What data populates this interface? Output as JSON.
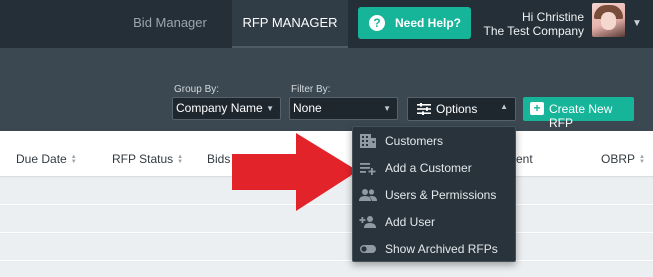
{
  "nav": {
    "tabs": [
      {
        "label": "Bid Manager",
        "active": false
      },
      {
        "label": "RFP MANAGER",
        "active": true
      }
    ],
    "help_label": "Need Help?",
    "user_greeting": "Hi Christine",
    "user_company": "The Test Company"
  },
  "filters": {
    "group_by_label": "Group By:",
    "group_by_value": "Company Name",
    "filter_by_label": "Filter By:",
    "filter_by_value": "None",
    "options_label": "Options",
    "create_label": "Create New RFP"
  },
  "table": {
    "columns": [
      "Due Date",
      "RFP Status",
      "Bids",
      "ent",
      "OBRP"
    ]
  },
  "options_menu": {
    "items": [
      {
        "label": "Customers",
        "icon": "building-icon"
      },
      {
        "label": "Add a Customer",
        "icon": "playlist-add-icon"
      },
      {
        "label": "Users & Permissions",
        "icon": "people-icon"
      },
      {
        "label": "Add User",
        "icon": "person-add-icon"
      },
      {
        "label": "Show Archived RFPs",
        "icon": "toggle-icon"
      }
    ]
  },
  "colors": {
    "accent": "#16b59a",
    "topbar": "#242f37",
    "filterbar": "#3b4852",
    "annotation_arrow": "#e3232a"
  }
}
